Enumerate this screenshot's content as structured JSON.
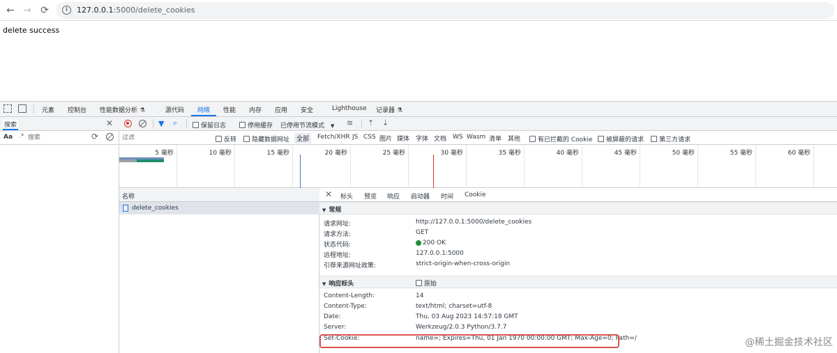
{
  "browser": {
    "url_host": "127.0.0.1",
    "url_rest": ":5000/delete_cookies"
  },
  "page": {
    "body_text": "delete success"
  },
  "devtools": {
    "tabs": [
      "元素",
      "控制台",
      "性能数据分析 ⚗",
      "源代码",
      "网络",
      "性能",
      "内存",
      "应用",
      "安全",
      "Lighthouse",
      "记录器 ⚗"
    ],
    "active_tab": "网络",
    "search": {
      "title": "搜索",
      "aa": "Aa",
      "regex": ".*",
      "placeholder": "搜索"
    },
    "toolbar": {
      "preserve_log": "保留日志",
      "disable_cache": "停用缓存",
      "throttle": "已停用节流模式"
    },
    "filter": {
      "placeholder": "过滤",
      "invert": "反转",
      "hide_data_urls": "隐藏数据网址",
      "types": [
        "全部",
        "Fetch/XHR",
        "JS",
        "CSS",
        "图片",
        "媒体",
        "字体",
        "文档",
        "WS",
        "Wasm",
        "清单",
        "其他"
      ],
      "blocked_cookies": "有已拦截的 Cookie",
      "blocked_requests": "被屏蔽的请求",
      "third_party": "第三方请求"
    },
    "overview_ticks": [
      "5 毫秒",
      "10 毫秒",
      "15 毫秒",
      "20 毫秒",
      "25 毫秒",
      "30 毫秒",
      "35 毫秒",
      "40 毫秒",
      "45 毫秒",
      "50 毫秒",
      "55 毫秒",
      "60 毫秒"
    ],
    "request_list": {
      "header": "名称",
      "rows": [
        "delete_cookies"
      ]
    },
    "details": {
      "tabs": [
        "标头",
        "预览",
        "响应",
        "启动器",
        "时间",
        "Cookie"
      ],
      "active_tab": "标头",
      "general": {
        "title": "常规",
        "rows": [
          {
            "k": "请求网址:",
            "v": "http://127.0.0.1:5000/delete_cookies"
          },
          {
            "k": "请求方法:",
            "v": "GET"
          },
          {
            "k": "状态代码:",
            "v": "200 OK"
          },
          {
            "k": "远程地址:",
            "v": "127.0.0.1:5000"
          },
          {
            "k": "引荐来源网址政策:",
            "v": "strict-origin-when-cross-origin"
          }
        ]
      },
      "response_headers": {
        "title": "响应标头",
        "raw_label": "原始",
        "rows": [
          {
            "k": "Content-Length:",
            "v": "14"
          },
          {
            "k": "Content-Type:",
            "v": "text/html; charset=utf-8"
          },
          {
            "k": "Date:",
            "v": "Thu, 03 Aug 2023 14:57:18 GMT"
          },
          {
            "k": "Server:",
            "v": "Werkzeug/2.0.3 Python/3.7.7"
          },
          {
            "k": "Set-Cookie:",
            "v": "name=; Expires=Thu, 01 Jan 1970 00:00:00 GMT; Max-Age=0; Path=/"
          }
        ]
      }
    }
  },
  "watermark": "@稀土掘金技术社区",
  "colors": {
    "accent": "#1a73e8",
    "highlight": "#d9534f",
    "status_ok": "#1e8e3e",
    "record": "#d93025"
  }
}
